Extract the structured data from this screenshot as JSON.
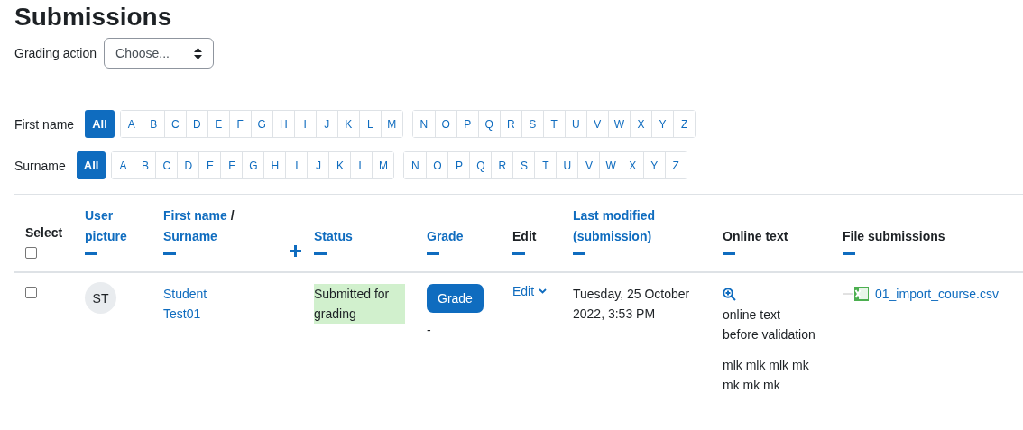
{
  "title": "Submissions",
  "grading_action": {
    "label": "Grading action",
    "value": "Choose..."
  },
  "filters": [
    {
      "label": "First name",
      "all": {
        "label": "All",
        "selected": true
      },
      "groups": [
        [
          "A",
          "B",
          "C",
          "D",
          "E",
          "F",
          "G",
          "H",
          "I",
          "J",
          "K",
          "L",
          "M"
        ],
        [
          "N",
          "O",
          "P",
          "Q",
          "R",
          "S",
          "T",
          "U",
          "V",
          "W",
          "X",
          "Y",
          "Z"
        ]
      ]
    },
    {
      "label": "Surname",
      "all": {
        "label": "All",
        "selected": true
      },
      "groups": [
        [
          "A",
          "B",
          "C",
          "D",
          "E",
          "F",
          "G",
          "H",
          "I",
          "J",
          "K",
          "L",
          "M"
        ],
        [
          "N",
          "O",
          "P",
          "Q",
          "R",
          "S",
          "T",
          "U",
          "V",
          "W",
          "X",
          "Y",
          "Z"
        ]
      ]
    }
  ],
  "columns": [
    {
      "label": "Select",
      "link": false,
      "checkbox": {
        "checked": false
      }
    },
    {
      "label": "User picture",
      "link": true
    },
    {
      "label": "First name",
      "separator": "/",
      "label2": "Surname",
      "link": true,
      "collapsed_neighbor": true
    },
    {
      "label": "Status",
      "link": true
    },
    {
      "label": "Grade",
      "link": true
    },
    {
      "label": "Edit",
      "link": false
    },
    {
      "label": "Last modified (submission)",
      "link": true
    },
    {
      "label": "Online text",
      "link": false
    },
    {
      "label": "File submissions",
      "link": false
    }
  ],
  "rows": [
    {
      "checked": false,
      "initials": "ST",
      "name": "Student Test01",
      "status": {
        "text": "Submitted for grading",
        "color": "#d1f0cd"
      },
      "grade_button": "Grade",
      "grade": "-",
      "edit": "Edit",
      "last_modified": "Tuesday, 25 October 2022, 3:53 PM",
      "online_text": [
        "online text before validation",
        "mlk mlk mlk mk mk mk mk"
      ],
      "file": "01_import_course.csv"
    }
  ]
}
